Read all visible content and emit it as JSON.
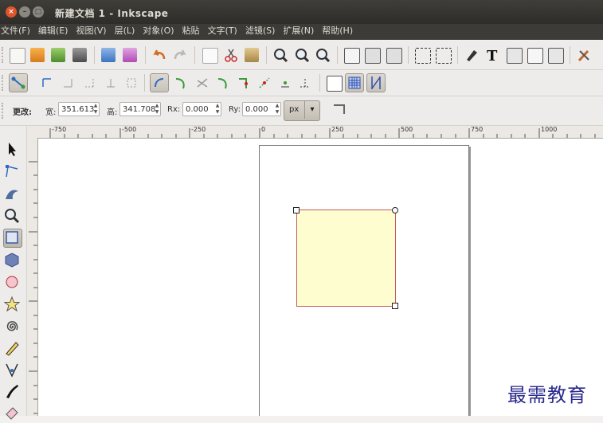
{
  "window": {
    "title": "新建文档 1 - Inkscape"
  },
  "menu": [
    "文件(F)",
    "编辑(E)",
    "视图(V)",
    "层(L)",
    "对象(O)",
    "粘贴",
    "文字(T)",
    "滤镜(S)",
    "扩展(N)",
    "帮助(H)"
  ],
  "controls": {
    "change_label": "更改:",
    "width_label": "宽:",
    "width_value": "351.613",
    "height_label": "高:",
    "height_value": "341.708",
    "rx_label": "Rx:",
    "rx_value": "0.000",
    "ry_label": "Ry:",
    "ry_value": "0.000",
    "unit": "px"
  },
  "ruler": {
    "ticks": [
      "-750",
      "-500",
      "-250",
      "0",
      "250",
      "500",
      "750",
      "1000"
    ]
  },
  "watermark": "最需教育",
  "colors": {
    "rect_fill": "#fdfdd0",
    "rect_stroke": "#c9595a",
    "accent": "#3e5f9e"
  }
}
